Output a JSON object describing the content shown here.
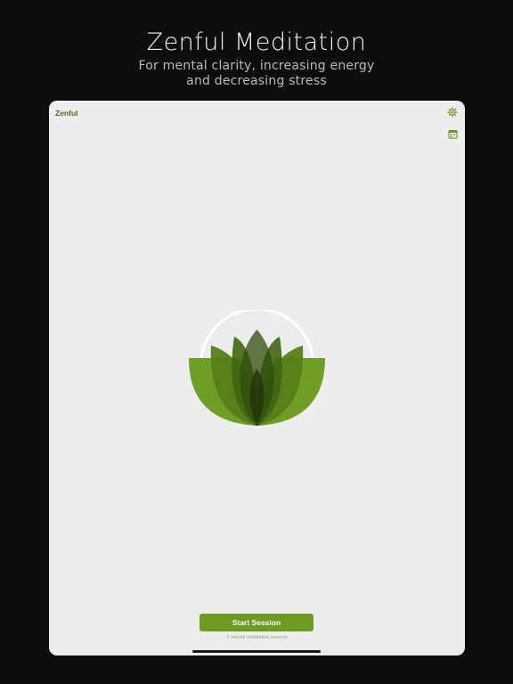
{
  "promo": {
    "title": "Zenful Meditation",
    "subtitle_line1": "For mental clarity, increasing energy",
    "subtitle_line2": "and decreasing stress"
  },
  "app": {
    "title": "Zenful",
    "accent_color": "#6e9a1f",
    "icons": {
      "settings": "gear-icon",
      "history": "calendar-icon",
      "logo": "lotus-icon"
    }
  },
  "session": {
    "start_label": "Start Session",
    "caption": "2 minute meditation session"
  }
}
